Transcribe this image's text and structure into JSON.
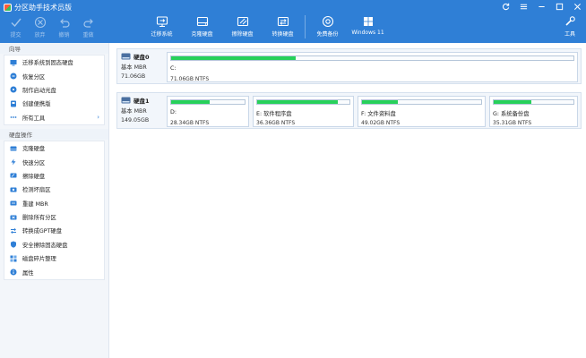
{
  "window": {
    "title": "分区助手技术员版"
  },
  "toolbar_left": [
    {
      "label": "提交",
      "icon": "check-icon"
    },
    {
      "label": "放弃",
      "icon": "discard-icon"
    },
    {
      "label": "撤销",
      "icon": "undo-icon"
    },
    {
      "label": "重做",
      "icon": "redo-icon"
    }
  ],
  "toolbar_main": [
    {
      "label": "迁移系统",
      "icon": "migrate-system-icon"
    },
    {
      "label": "克隆硬盘",
      "icon": "clone-disk-icon"
    },
    {
      "label": "擦除硬盘",
      "icon": "wipe-disk-icon"
    },
    {
      "label": "转换硬盘",
      "icon": "convert-disk-icon"
    },
    {
      "label": "免费备份",
      "icon": "free-backup-icon"
    },
    {
      "label": "Windows 11",
      "icon": "windows11-icon"
    }
  ],
  "toolbar_right": {
    "label": "工具",
    "icon": "tools-icon"
  },
  "sidebar": {
    "wizard_title": "向导",
    "wizard_items": [
      {
        "label": "迁移系统到固态硬盘",
        "icon": "migrate-icon"
      },
      {
        "label": "恢复分区",
        "icon": "recover-icon"
      },
      {
        "label": "制作启动光盘",
        "icon": "boot-disc-icon"
      },
      {
        "label": "创建便携版",
        "icon": "portable-icon"
      },
      {
        "label": "所有工具",
        "icon": "more-icon"
      }
    ],
    "disk_ops_title": "硬盘操作",
    "disk_ops_items": [
      {
        "label": "克隆硬盘",
        "icon": "clone-icon"
      },
      {
        "label": "快速分区",
        "icon": "lightning-icon"
      },
      {
        "label": "擦除硬盘",
        "icon": "wipe-icon"
      },
      {
        "label": "检测坏扇区",
        "icon": "scan-icon"
      },
      {
        "label": "重建 MBR",
        "icon": "rebuild-icon"
      },
      {
        "label": "删除所有分区",
        "icon": "delete-icon"
      },
      {
        "label": "转换成GPT硬盘",
        "icon": "convert-icon"
      },
      {
        "label": "安全擦除固态硬盘",
        "icon": "secure-erase-icon"
      },
      {
        "label": "磁盘碎片整理",
        "icon": "defrag-icon"
      },
      {
        "label": "属性",
        "icon": "info-icon"
      }
    ]
  },
  "disks": [
    {
      "name": "硬盘0",
      "type": "基本 MBR",
      "size": "71.06GB",
      "partitions": [
        {
          "name": "C:",
          "desc": "71.06GB NTFS",
          "used_fraction": 0.31
        }
      ]
    },
    {
      "name": "硬盘1",
      "type": "基本 MBR",
      "size": "149.05GB",
      "partitions": [
        {
          "name": "D:",
          "desc": "28.34GB NTFS",
          "used_fraction": 0.53
        },
        {
          "name": "E: 软件程序盘",
          "desc": "36.36GB NTFS",
          "used_fraction": 0.87
        },
        {
          "name": "F: 文件资料盘",
          "desc": "49.02GB NTFS",
          "used_fraction": 0.3
        },
        {
          "name": "G: 系统备份盘",
          "desc": "35.31GB NTFS",
          "used_fraction": 0.47
        }
      ]
    }
  ],
  "colors": {
    "accent": "#2f7fd6",
    "used": "#27d15a"
  }
}
